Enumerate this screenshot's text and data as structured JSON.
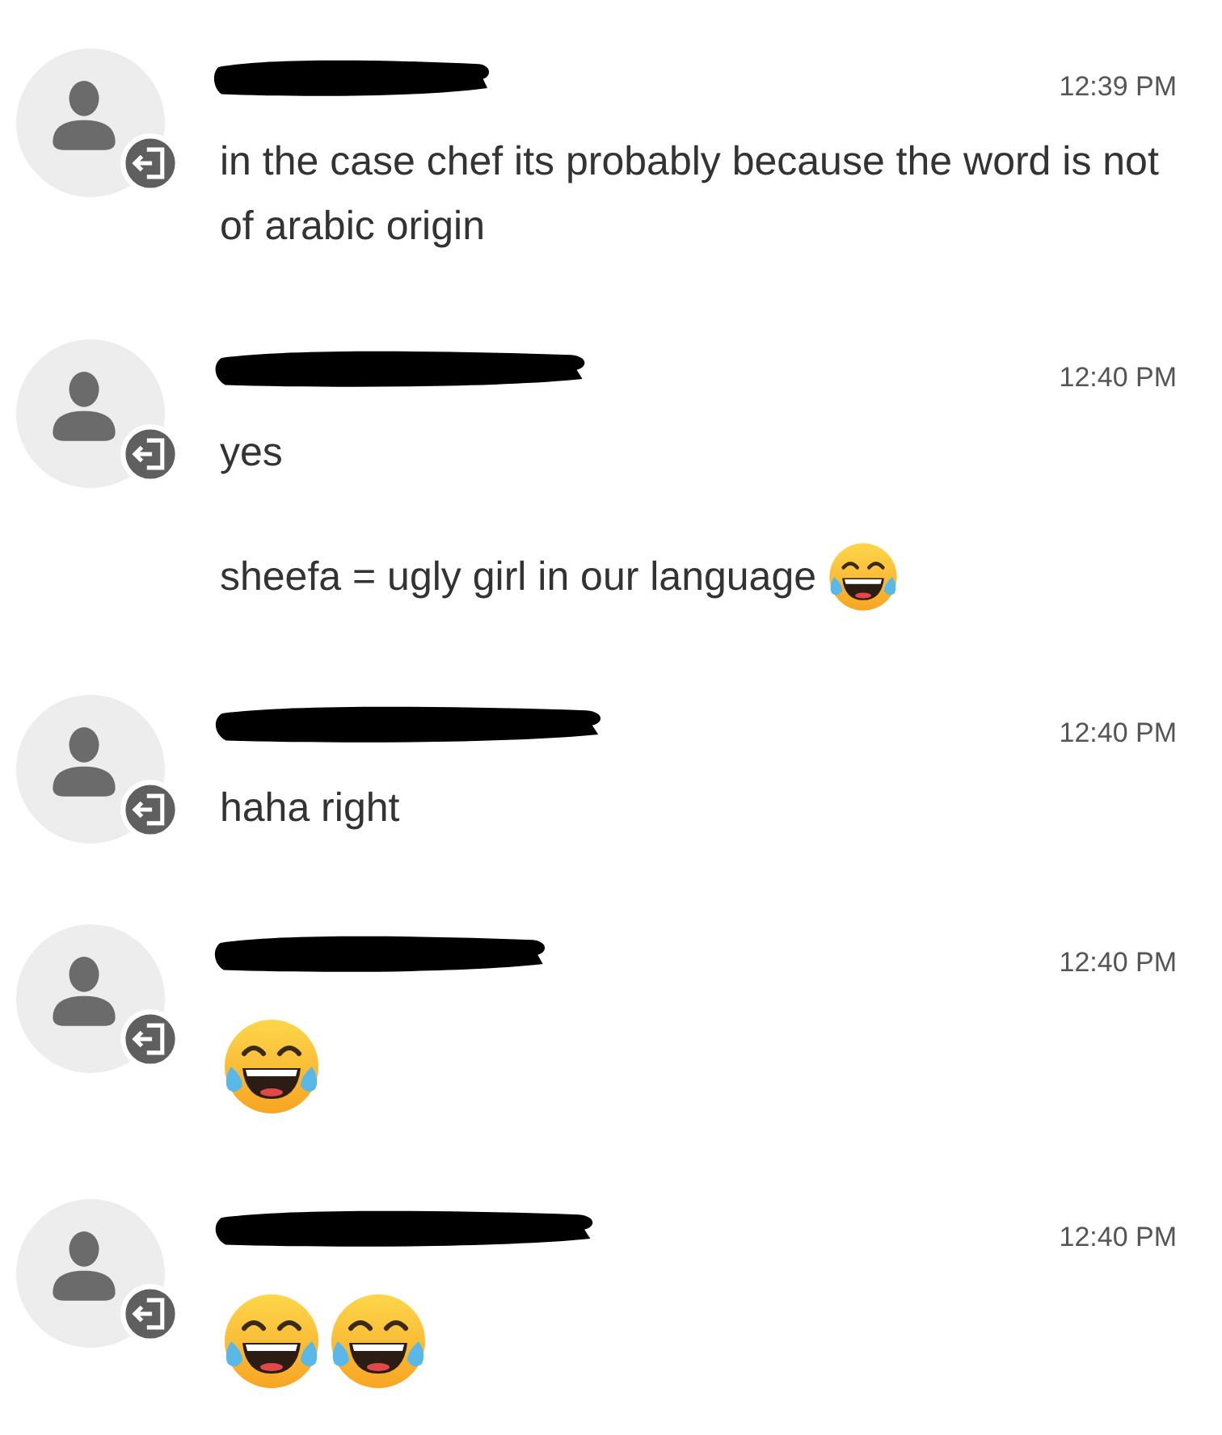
{
  "messages": [
    {
      "time": "12:39 PM",
      "paragraphs": [
        [
          {
            "kind": "text",
            "text": "in the case chef its probably because the word is not of arabic origin"
          }
        ]
      ]
    },
    {
      "time": "12:40 PM",
      "paragraphs": [
        [
          {
            "kind": "text",
            "text": "yes"
          }
        ],
        [
          {
            "kind": "text",
            "text": "sheefa = ugly girl in our language"
          },
          {
            "kind": "emoji"
          }
        ]
      ]
    },
    {
      "time": "12:40 PM",
      "paragraphs": [
        [
          {
            "kind": "text",
            "text": "haha right"
          }
        ]
      ]
    },
    {
      "time": "12:40 PM",
      "paragraphs": [
        [
          {
            "kind": "emoji"
          }
        ]
      ]
    },
    {
      "time": "12:40 PM",
      "paragraphs": [
        [
          {
            "kind": "emoji"
          },
          {
            "kind": "emoji"
          }
        ]
      ]
    }
  ]
}
